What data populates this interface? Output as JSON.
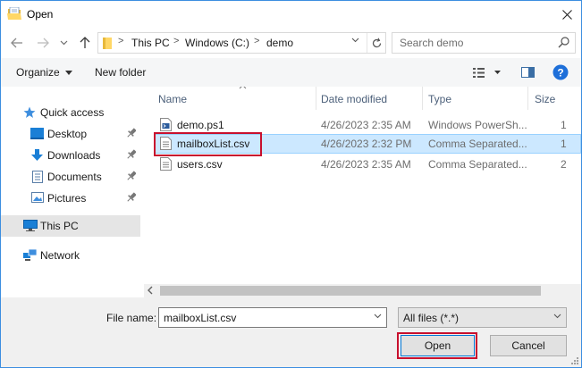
{
  "window": {
    "title": "Open",
    "icons": {
      "app": "open-folder-icon",
      "close": "close-icon"
    }
  },
  "navigation": {
    "icons": [
      "back-arrow-icon",
      "forward-arrow-icon",
      "recent-chevron-icon",
      "up-arrow-icon"
    ],
    "breadcrumb": [
      "This PC",
      "Windows (C:)",
      "demo"
    ],
    "search_placeholder": "Search demo"
  },
  "toolbar": {
    "organize_label": "Organize",
    "new_folder_label": "New folder",
    "icons": [
      "view-options-icon",
      "preview-pane-icon",
      "help-icon"
    ]
  },
  "nav_pane": {
    "items": [
      {
        "label": "Quick access",
        "icon": "star-icon"
      },
      {
        "label": "Desktop",
        "icon": "desktop-icon",
        "pinned": true
      },
      {
        "label": "Downloads",
        "icon": "download-icon",
        "pinned": true
      },
      {
        "label": "Documents",
        "icon": "documents-icon",
        "pinned": true
      },
      {
        "label": "Pictures",
        "icon": "pictures-icon",
        "pinned": true
      },
      {
        "label": "This PC",
        "icon": "computer-icon",
        "selected": true
      },
      {
        "label": "Network",
        "icon": "network-icon"
      }
    ]
  },
  "file_list": {
    "columns": [
      "Name",
      "Date modified",
      "Type",
      "Size"
    ],
    "rows": [
      {
        "name": "demo.ps1",
        "date": "4/26/2023 2:35 AM",
        "type": "Windows PowerSh...",
        "size": "1",
        "icon": "powershell-script-icon"
      },
      {
        "name": "mailboxList.csv",
        "date": "4/26/2023 2:32 PM",
        "type": "Comma Separated...",
        "size": "1",
        "icon": "csv-file-icon",
        "selected": true,
        "highlighted": true
      },
      {
        "name": "users.csv",
        "date": "4/26/2023 2:35 AM",
        "type": "Comma Separated...",
        "size": "2",
        "icon": "csv-file-icon"
      }
    ]
  },
  "footer": {
    "file_name_label": "File name:",
    "file_name_value": "mailboxList.csv",
    "file_type_value": "All files (*.*)",
    "open_label": "Open",
    "cancel_label": "Cancel"
  },
  "colors": {
    "window_border": "#3c8ee0",
    "selection_bg": "#cce8ff",
    "selection_border": "#99d1ff",
    "highlight_red": "#c8102e",
    "help_blue": "#1e6fd9",
    "folder_yellow": "#ffd766"
  }
}
